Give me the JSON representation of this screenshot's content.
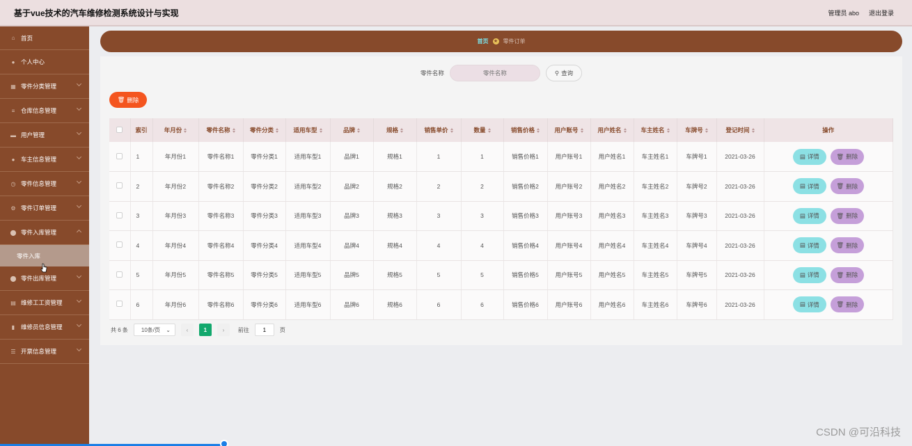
{
  "header": {
    "title": "基于vue技术的汽车维修检测系统设计与实现",
    "user": "管理员 abo",
    "logout": "退出登录"
  },
  "sidebar": {
    "items": [
      {
        "label": "首页",
        "icon": "home-icon"
      },
      {
        "label": "个人中心",
        "icon": "user-icon"
      },
      {
        "label": "零件分类管理",
        "icon": "grid-icon"
      },
      {
        "label": "仓库信息管理",
        "icon": "list-icon"
      },
      {
        "label": "用户管理",
        "icon": "monitor-icon"
      },
      {
        "label": "车主信息管理",
        "icon": "user-icon"
      },
      {
        "label": "零件信息管理",
        "icon": "clock-icon"
      },
      {
        "label": "零件订单管理",
        "icon": "settings-icon"
      },
      {
        "label": "零件入库管理",
        "icon": "pin-icon"
      },
      {
        "label": "零件入库",
        "icon": ""
      },
      {
        "label": "零件出库管理",
        "icon": "pin-icon"
      },
      {
        "label": "维修工工资管理",
        "icon": "doc-icon"
      },
      {
        "label": "维修员信息管理",
        "icon": "chart-icon"
      },
      {
        "label": "开票信息管理",
        "icon": "menu-icon"
      }
    ]
  },
  "breadcrumb": {
    "home": "首页",
    "current": "零件订单"
  },
  "search": {
    "label": "零件名称",
    "placeholder": "零件名称",
    "button": "查询"
  },
  "actions": {
    "delete": "删除"
  },
  "table": {
    "headers": [
      "索引",
      "年月份",
      "零件名称",
      "零件分类",
      "适用车型",
      "品牌",
      "规格",
      "销售单价",
      "数量",
      "销售价格",
      "用户账号",
      "用户姓名",
      "车主姓名",
      "车牌号",
      "登记时间",
      "操作"
    ],
    "rows": [
      [
        "1",
        "年月份1",
        "零件名称1",
        "零件分类1",
        "适用车型1",
        "品牌1",
        "规格1",
        "1",
        "1",
        "销售价格1",
        "用户账号1",
        "用户姓名1",
        "车主姓名1",
        "车牌号1",
        "2021-03-26"
      ],
      [
        "2",
        "年月份2",
        "零件名称2",
        "零件分类2",
        "适用车型2",
        "品牌2",
        "规格2",
        "2",
        "2",
        "销售价格2",
        "用户账号2",
        "用户姓名2",
        "车主姓名2",
        "车牌号2",
        "2021-03-26"
      ],
      [
        "3",
        "年月份3",
        "零件名称3",
        "零件分类3",
        "适用车型3",
        "品牌3",
        "规格3",
        "3",
        "3",
        "销售价格3",
        "用户账号3",
        "用户姓名3",
        "车主姓名3",
        "车牌号3",
        "2021-03-26"
      ],
      [
        "4",
        "年月份4",
        "零件名称4",
        "零件分类4",
        "适用车型4",
        "品牌4",
        "规格4",
        "4",
        "4",
        "销售价格4",
        "用户账号4",
        "用户姓名4",
        "车主姓名4",
        "车牌号4",
        "2021-03-26"
      ],
      [
        "5",
        "年月份5",
        "零件名称5",
        "零件分类5",
        "适用车型5",
        "品牌5",
        "规格5",
        "5",
        "5",
        "销售价格5",
        "用户账号5",
        "用户姓名5",
        "车主姓名5",
        "车牌号5",
        "2021-03-26"
      ],
      [
        "6",
        "年月份6",
        "零件名称6",
        "零件分类6",
        "适用车型6",
        "品牌6",
        "规格6",
        "6",
        "6",
        "销售价格6",
        "用户账号6",
        "用户姓名6",
        "车主姓名6",
        "车牌号6",
        "2021-03-26"
      ]
    ],
    "detail_label": "详情",
    "delete_label": "删除"
  },
  "pagination": {
    "total": "共 6 条",
    "page_size": "10条/页",
    "current": "1",
    "goto_label": "前往",
    "goto_value": "1",
    "page_unit": "页"
  },
  "watermark": "CSDN @可沿科技",
  "colors": {
    "sidebar": "#874a2b",
    "accent_delete": "#f4551f",
    "detail": "#8ce0e4",
    "row_delete": "#c59fd9",
    "page_active": "#12a86d"
  }
}
